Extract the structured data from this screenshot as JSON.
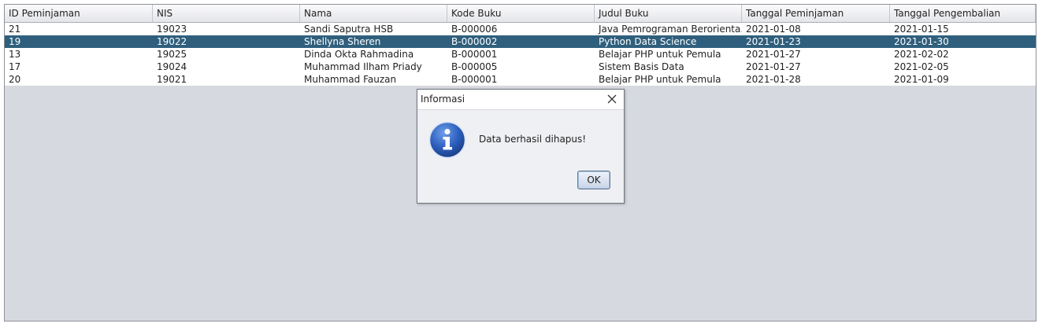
{
  "table": {
    "columns": [
      "ID Peminjaman",
      "NIS",
      "Nama",
      "Kode Buku",
      "Judul Buku",
      "Tanggal Peminjaman",
      "Tanggal Pengembalian"
    ],
    "rows": [
      [
        "21",
        "19023",
        "Sandi Saputra HSB",
        "B-000006",
        "Java Pemrograman Berorienta...",
        "2021-01-08",
        "2021-01-15"
      ],
      [
        "19",
        "19022",
        "Shellyna Sheren",
        "B-000002",
        "Python Data Science",
        "2021-01-23",
        "2021-01-30"
      ],
      [
        "13",
        "19025",
        "Dinda Okta Rahmadina",
        "B-000001",
        "Belajar PHP untuk Pemula",
        "2021-01-27",
        "2021-02-02"
      ],
      [
        "17",
        "19024",
        "Muhammad Ilham Priady",
        "B-000005",
        "Sistem Basis Data",
        "2021-01-27",
        "2021-02-05"
      ],
      [
        "20",
        "19021",
        "Muhammad Fauzan",
        "B-000001",
        "Belajar PHP untuk Pemula",
        "2021-01-28",
        "2021-01-09"
      ]
    ],
    "selected_row_index": 1,
    "selection_color": "#2f5f7d"
  },
  "dialog": {
    "title": "Informasi",
    "message": "Data berhasil dihapus!",
    "ok_label": "OK",
    "icon": "info-icon",
    "close_icon": "close-icon"
  }
}
